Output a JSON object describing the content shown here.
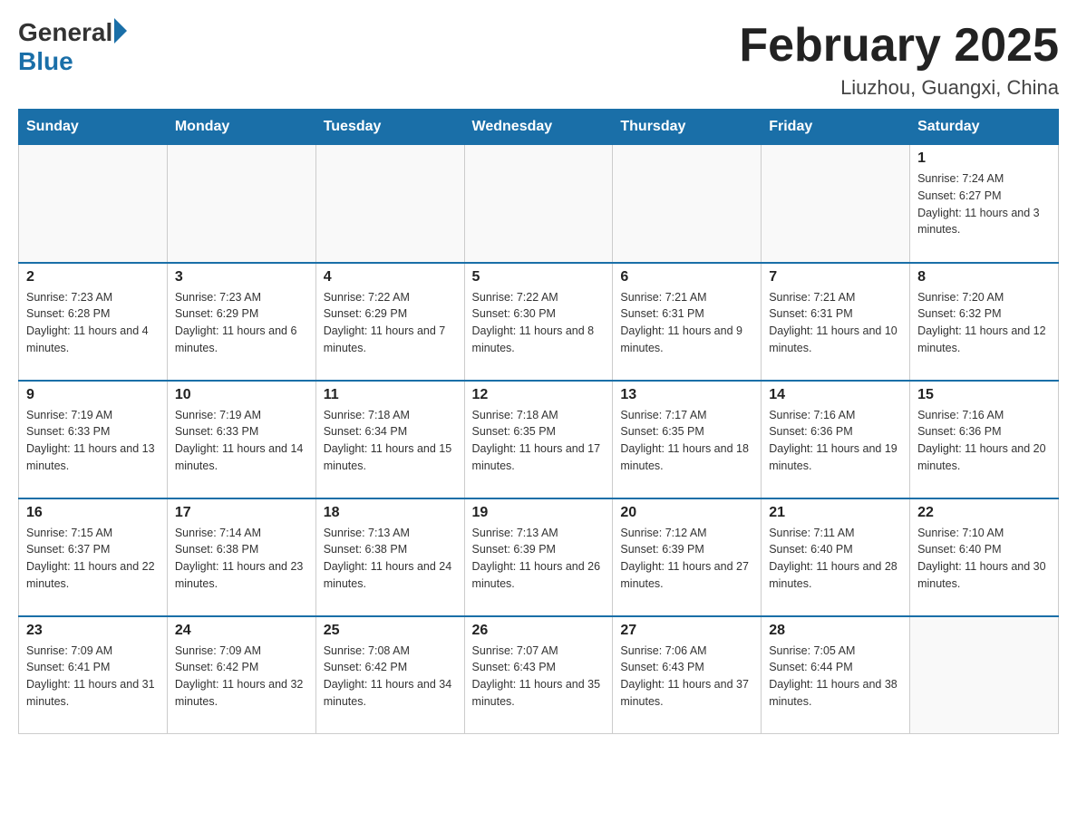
{
  "logo": {
    "general": "General",
    "blue": "Blue"
  },
  "title": "February 2025",
  "subtitle": "Liuzhou, Guangxi, China",
  "weekdays": [
    "Sunday",
    "Monday",
    "Tuesday",
    "Wednesday",
    "Thursday",
    "Friday",
    "Saturday"
  ],
  "weeks": [
    [
      {
        "day": "",
        "sunrise": "",
        "sunset": "",
        "daylight": ""
      },
      {
        "day": "",
        "sunrise": "",
        "sunset": "",
        "daylight": ""
      },
      {
        "day": "",
        "sunrise": "",
        "sunset": "",
        "daylight": ""
      },
      {
        "day": "",
        "sunrise": "",
        "sunset": "",
        "daylight": ""
      },
      {
        "day": "",
        "sunrise": "",
        "sunset": "",
        "daylight": ""
      },
      {
        "day": "",
        "sunrise": "",
        "sunset": "",
        "daylight": ""
      },
      {
        "day": "1",
        "sunrise": "Sunrise: 7:24 AM",
        "sunset": "Sunset: 6:27 PM",
        "daylight": "Daylight: 11 hours and 3 minutes."
      }
    ],
    [
      {
        "day": "2",
        "sunrise": "Sunrise: 7:23 AM",
        "sunset": "Sunset: 6:28 PM",
        "daylight": "Daylight: 11 hours and 4 minutes."
      },
      {
        "day": "3",
        "sunrise": "Sunrise: 7:23 AM",
        "sunset": "Sunset: 6:29 PM",
        "daylight": "Daylight: 11 hours and 6 minutes."
      },
      {
        "day": "4",
        "sunrise": "Sunrise: 7:22 AM",
        "sunset": "Sunset: 6:29 PM",
        "daylight": "Daylight: 11 hours and 7 minutes."
      },
      {
        "day": "5",
        "sunrise": "Sunrise: 7:22 AM",
        "sunset": "Sunset: 6:30 PM",
        "daylight": "Daylight: 11 hours and 8 minutes."
      },
      {
        "day": "6",
        "sunrise": "Sunrise: 7:21 AM",
        "sunset": "Sunset: 6:31 PM",
        "daylight": "Daylight: 11 hours and 9 minutes."
      },
      {
        "day": "7",
        "sunrise": "Sunrise: 7:21 AM",
        "sunset": "Sunset: 6:31 PM",
        "daylight": "Daylight: 11 hours and 10 minutes."
      },
      {
        "day": "8",
        "sunrise": "Sunrise: 7:20 AM",
        "sunset": "Sunset: 6:32 PM",
        "daylight": "Daylight: 11 hours and 12 minutes."
      }
    ],
    [
      {
        "day": "9",
        "sunrise": "Sunrise: 7:19 AM",
        "sunset": "Sunset: 6:33 PM",
        "daylight": "Daylight: 11 hours and 13 minutes."
      },
      {
        "day": "10",
        "sunrise": "Sunrise: 7:19 AM",
        "sunset": "Sunset: 6:33 PM",
        "daylight": "Daylight: 11 hours and 14 minutes."
      },
      {
        "day": "11",
        "sunrise": "Sunrise: 7:18 AM",
        "sunset": "Sunset: 6:34 PM",
        "daylight": "Daylight: 11 hours and 15 minutes."
      },
      {
        "day": "12",
        "sunrise": "Sunrise: 7:18 AM",
        "sunset": "Sunset: 6:35 PM",
        "daylight": "Daylight: 11 hours and 17 minutes."
      },
      {
        "day": "13",
        "sunrise": "Sunrise: 7:17 AM",
        "sunset": "Sunset: 6:35 PM",
        "daylight": "Daylight: 11 hours and 18 minutes."
      },
      {
        "day": "14",
        "sunrise": "Sunrise: 7:16 AM",
        "sunset": "Sunset: 6:36 PM",
        "daylight": "Daylight: 11 hours and 19 minutes."
      },
      {
        "day": "15",
        "sunrise": "Sunrise: 7:16 AM",
        "sunset": "Sunset: 6:36 PM",
        "daylight": "Daylight: 11 hours and 20 minutes."
      }
    ],
    [
      {
        "day": "16",
        "sunrise": "Sunrise: 7:15 AM",
        "sunset": "Sunset: 6:37 PM",
        "daylight": "Daylight: 11 hours and 22 minutes."
      },
      {
        "day": "17",
        "sunrise": "Sunrise: 7:14 AM",
        "sunset": "Sunset: 6:38 PM",
        "daylight": "Daylight: 11 hours and 23 minutes."
      },
      {
        "day": "18",
        "sunrise": "Sunrise: 7:13 AM",
        "sunset": "Sunset: 6:38 PM",
        "daylight": "Daylight: 11 hours and 24 minutes."
      },
      {
        "day": "19",
        "sunrise": "Sunrise: 7:13 AM",
        "sunset": "Sunset: 6:39 PM",
        "daylight": "Daylight: 11 hours and 26 minutes."
      },
      {
        "day": "20",
        "sunrise": "Sunrise: 7:12 AM",
        "sunset": "Sunset: 6:39 PM",
        "daylight": "Daylight: 11 hours and 27 minutes."
      },
      {
        "day": "21",
        "sunrise": "Sunrise: 7:11 AM",
        "sunset": "Sunset: 6:40 PM",
        "daylight": "Daylight: 11 hours and 28 minutes."
      },
      {
        "day": "22",
        "sunrise": "Sunrise: 7:10 AM",
        "sunset": "Sunset: 6:40 PM",
        "daylight": "Daylight: 11 hours and 30 minutes."
      }
    ],
    [
      {
        "day": "23",
        "sunrise": "Sunrise: 7:09 AM",
        "sunset": "Sunset: 6:41 PM",
        "daylight": "Daylight: 11 hours and 31 minutes."
      },
      {
        "day": "24",
        "sunrise": "Sunrise: 7:09 AM",
        "sunset": "Sunset: 6:42 PM",
        "daylight": "Daylight: 11 hours and 32 minutes."
      },
      {
        "day": "25",
        "sunrise": "Sunrise: 7:08 AM",
        "sunset": "Sunset: 6:42 PM",
        "daylight": "Daylight: 11 hours and 34 minutes."
      },
      {
        "day": "26",
        "sunrise": "Sunrise: 7:07 AM",
        "sunset": "Sunset: 6:43 PM",
        "daylight": "Daylight: 11 hours and 35 minutes."
      },
      {
        "day": "27",
        "sunrise": "Sunrise: 7:06 AM",
        "sunset": "Sunset: 6:43 PM",
        "daylight": "Daylight: 11 hours and 37 minutes."
      },
      {
        "day": "28",
        "sunrise": "Sunrise: 7:05 AM",
        "sunset": "Sunset: 6:44 PM",
        "daylight": "Daylight: 11 hours and 38 minutes."
      },
      {
        "day": "",
        "sunrise": "",
        "sunset": "",
        "daylight": ""
      }
    ]
  ]
}
